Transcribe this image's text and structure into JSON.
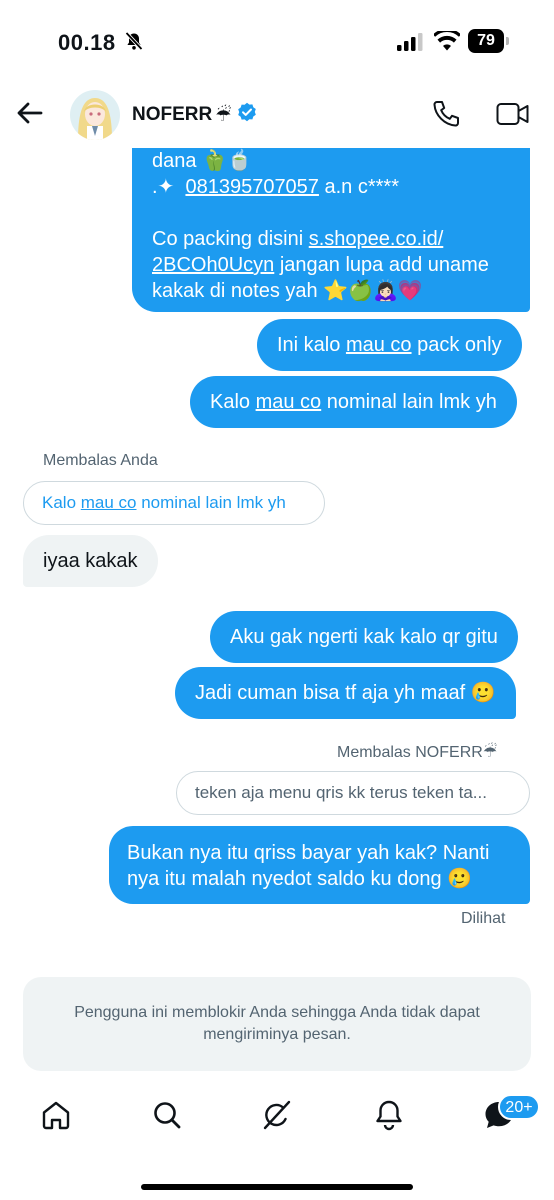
{
  "status_bar": {
    "time": "00.18",
    "battery": "79"
  },
  "header": {
    "name": "NOFERR",
    "name_emoji": "☔"
  },
  "thread": {
    "top_bubble": {
      "line1_text": "dana ",
      "line1_emoji": "🫑🍵",
      "line2_sparkle": ".✦",
      "line2_phone": "081395707057",
      "line2_rest": " a.n c****",
      "line3_text": "Co packing disini ",
      "line3_link": "s.shopee.co.id/",
      "line4_link": "2BCOh0Ucyn",
      "line4_rest": " jangan lupa add uname",
      "line5_text": "kakak di notes yah ",
      "line5_emoji": "⭐🍏🙇🏻‍♀️💗"
    },
    "msg_pack_only": {
      "pre": "Ini kalo ",
      "link": "mau co",
      "post": " pack only"
    },
    "msg_nominal": {
      "pre": "Kalo ",
      "link": "mau co",
      "post": " nominal lain lmk yh"
    },
    "reply_label_1": "Membalas Anda",
    "quote_1": {
      "pre": "Kalo ",
      "link": "mau co",
      "post": " nominal lain lmk yh"
    },
    "msg_iyaa": "iyaa kakak",
    "msg_ngerti": "Aku gak ngerti kak kalo qr gitu",
    "msg_tf": "Jadi cuman bisa tf aja yh maaf ",
    "msg_tf_emoji": "🥲",
    "reply_label_2": "Membalas NOFERR",
    "reply_label_2_emoji": "☔",
    "quote_2": "teken aja menu qris kk terus teken ta...",
    "msg_bukan_1": "Bukan nya itu qriss bayar yah kak? Nanti",
    "msg_bukan_2": "nya itu malah nyedot saldo ku dong ",
    "msg_bukan_emoji": "🥲",
    "seen": "Dilihat"
  },
  "blocked_notice": {
    "line1": "Pengguna ini memblokir Anda sehingga Anda tidak dapat",
    "line2": "mengiriminya pesan."
  },
  "bottom_nav": {
    "icons": [
      "home-icon",
      "search-icon",
      "grok-icon",
      "notifications-icon",
      "messages-icon"
    ],
    "messages_badge": "20+"
  },
  "colors": {
    "accent": "#1d9bf0",
    "bubble_received": "#eff3f4",
    "text_secondary": "#536471"
  }
}
